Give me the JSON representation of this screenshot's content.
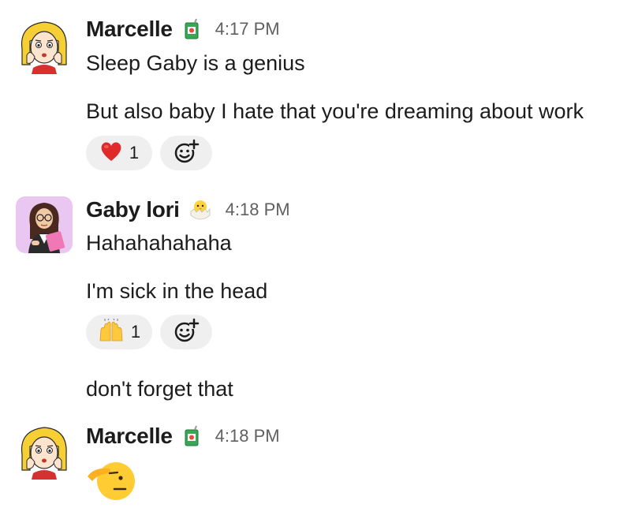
{
  "messages": [
    {
      "username": "Marcelle",
      "status_emoji": "juice-box-icon",
      "timestamp": "4:17 PM",
      "lines": [
        "Sleep Gaby is a genius",
        "But also baby I hate that you're dreaming about work"
      ],
      "reactions": [
        {
          "emoji": "red-heart-icon",
          "count": "1"
        }
      ]
    },
    {
      "username": "Gaby lori",
      "status_emoji": "hatching-chick-icon",
      "timestamp": "4:18 PM",
      "lines": [
        "Hahahahahaha",
        "I'm sick in the head"
      ],
      "reactions": [
        {
          "emoji": "raising-hands-icon",
          "count": "1"
        }
      ],
      "followup": "don't forget that"
    },
    {
      "username": "Marcelle",
      "status_emoji": "juice-box-icon",
      "timestamp": "4:18 PM",
      "big_emoji": "saluting-face-icon"
    }
  ]
}
